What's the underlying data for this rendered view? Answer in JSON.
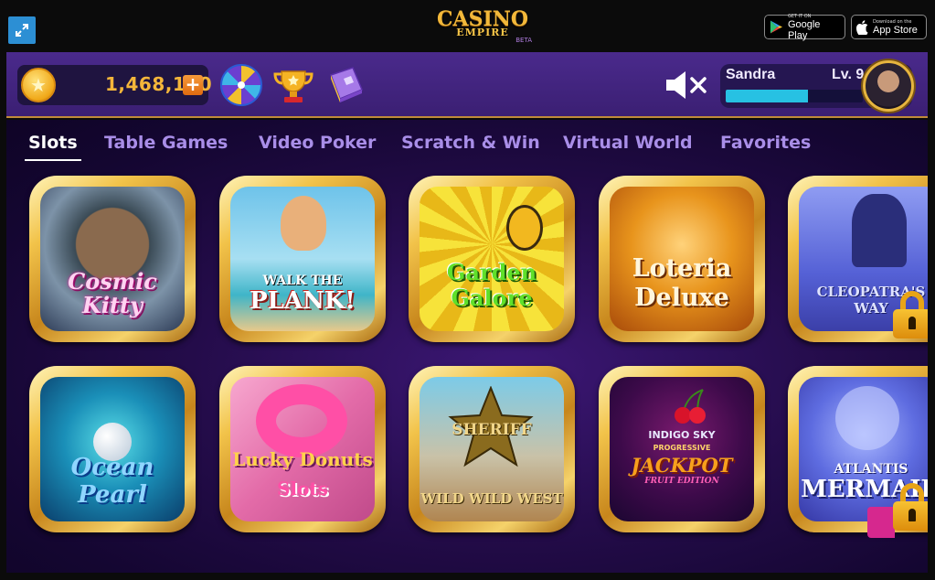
{
  "app": {
    "logo_top": "CASINO",
    "logo_bottom": "EMPIRE",
    "logo_badge": "BETA"
  },
  "stores": {
    "google_small": "GET IT ON",
    "google_big": "Google Play",
    "apple_small": "Download on the",
    "apple_big": "App Store"
  },
  "header": {
    "balance": "1,468,120",
    "icons": [
      "fullscreen-icon",
      "coin-icon",
      "plus-icon",
      "prize-wheel-icon",
      "trophy-icon",
      "book-icon",
      "speaker-muted-icon"
    ],
    "player": {
      "name": "Sandra",
      "level": "Lv. 9",
      "xp_fraction": 0.6
    }
  },
  "tabs": [
    {
      "label": "Slots",
      "active": true
    },
    {
      "label": "Table Games",
      "active": false
    },
    {
      "label": "Video Poker",
      "active": false
    },
    {
      "label": "Scratch & Win",
      "active": false
    },
    {
      "label": "Virtual World",
      "active": false
    },
    {
      "label": "Favorites",
      "active": false
    }
  ],
  "games": [
    {
      "line1": "Cosmic",
      "line2": "Kitty",
      "locked": false,
      "color": "#e31fa6"
    },
    {
      "line1": "WALK THE",
      "line2": "PLANK!",
      "locked": false,
      "color": "#c9221c"
    },
    {
      "line1": "Garden",
      "line2": "Galore",
      "locked": false,
      "color": "#3fc41a"
    },
    {
      "line1": "Loteria",
      "line2": "Deluxe",
      "locked": false,
      "color": "#ffd36a"
    },
    {
      "line1": "CLEOPATRA'S",
      "line2": "WAY",
      "locked": true,
      "color": "#b8c4ff"
    },
    {
      "line1": "Ocean",
      "line2": "Pearl",
      "locked": false,
      "color": "#2fa0ff"
    },
    {
      "line1": "Lucky Donuts",
      "line2": "Slots",
      "locked": false,
      "color": "#ff3fa2"
    },
    {
      "line1": "SHERIFF",
      "line2": "WILD WILD WEST",
      "locked": false,
      "color": "#e9c24a"
    },
    {
      "line1": "INDIGO SKY",
      "line2": "JACKPOT",
      "line3": "PROGRESSIVE",
      "line4": "FRUIT EDITION",
      "locked": false,
      "color": "#f39a1c"
    },
    {
      "line1": "ATLANTIS",
      "line2": "MERMAID",
      "locked": true,
      "color": "#e8eaff"
    }
  ],
  "colors": {
    "header_bg": "#4a2a8c",
    "accent_gold": "#f4b63a",
    "xp_bar": "#27c1e3",
    "tab_inactive": "#a98ee8"
  }
}
